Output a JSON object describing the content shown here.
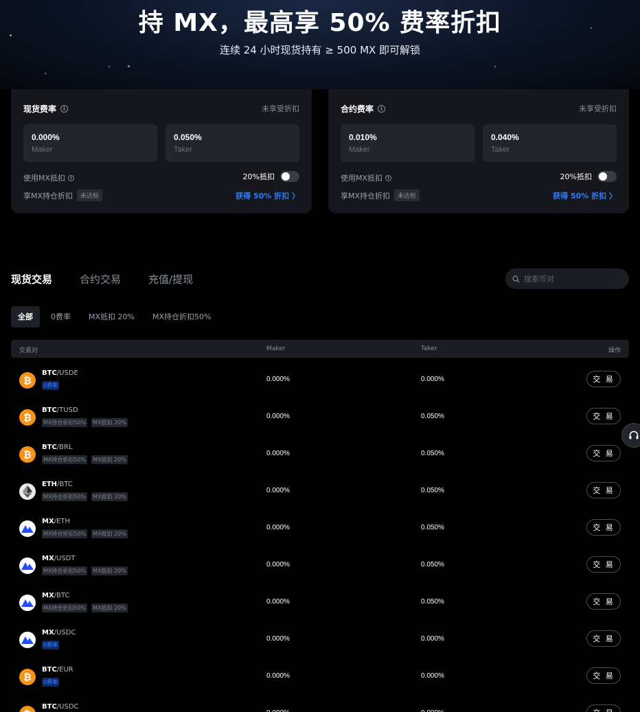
{
  "hero": {
    "title": "持 MX，最高享 50% 费率折扣",
    "subtitle": "连续 24 小时现货持有 ≥ 500 MX 即可解锁"
  },
  "cards": [
    {
      "title": "现货费率",
      "status": "未享受折扣",
      "maker_value": "0.000%",
      "maker_label": "Maker",
      "taker_value": "0.050%",
      "taker_label": "Taker",
      "mx_deduct_label": "使用MX抵扣",
      "mx_deduct_rate": "20%抵扣",
      "hold_label": "享MX持仓折扣",
      "hold_badge": "未达标",
      "hold_link": "获得 50% 折扣 〉"
    },
    {
      "title": "合约费率",
      "status": "未享受折扣",
      "maker_value": "0.010%",
      "maker_label": "Maker",
      "taker_value": "0.040%",
      "taker_label": "Taker",
      "mx_deduct_label": "使用MX抵扣",
      "mx_deduct_rate": "20%抵扣",
      "hold_label": "享MX持仓折扣",
      "hold_badge": "未达标",
      "hold_link": "获得 50% 折扣 〉"
    }
  ],
  "tabs": [
    "现货交易",
    "合约交易",
    "充值/提现"
  ],
  "search": {
    "placeholder": "搜索币对"
  },
  "filters": [
    "全部",
    "0费率",
    "MX抵扣 20%",
    "MX持仓折扣50%"
  ],
  "table": {
    "headers": {
      "pair": "交易对",
      "maker": "Maker",
      "taker": "Taker",
      "action": "操作"
    },
    "trade_label": "交 易",
    "rows": [
      {
        "coin": "btc",
        "base": "BTC",
        "quote": "/USDE",
        "tags": [
          {
            "text": "0费率",
            "style": "blue"
          }
        ],
        "maker": "0.000%",
        "taker": "0.000%"
      },
      {
        "coin": "btc",
        "base": "BTC",
        "quote": "/TUSD",
        "tags": [
          {
            "text": "MX持仓折扣50%",
            "style": "gray"
          },
          {
            "text": "MX抵扣 20%",
            "style": "gray"
          }
        ],
        "maker": "0.000%",
        "taker": "0.050%"
      },
      {
        "coin": "btc",
        "base": "BTC",
        "quote": "/BRL",
        "tags": [
          {
            "text": "MX持仓折扣50%",
            "style": "gray"
          },
          {
            "text": "MX抵扣 20%",
            "style": "gray"
          }
        ],
        "maker": "0.000%",
        "taker": "0.050%"
      },
      {
        "coin": "eth",
        "base": "ETH",
        "quote": "/BTC",
        "tags": [
          {
            "text": "MX持仓折扣50%",
            "style": "gray"
          },
          {
            "text": "MX抵扣 20%",
            "style": "gray"
          }
        ],
        "maker": "0.000%",
        "taker": "0.050%"
      },
      {
        "coin": "mx",
        "base": "MX",
        "quote": "/ETH",
        "tags": [
          {
            "text": "MX持仓折扣50%",
            "style": "gray"
          },
          {
            "text": "MX抵扣 20%",
            "style": "gray"
          }
        ],
        "maker": "0.000%",
        "taker": "0.050%"
      },
      {
        "coin": "mx",
        "base": "MX",
        "quote": "/USDT",
        "tags": [
          {
            "text": "MX持仓折扣50%",
            "style": "gray"
          },
          {
            "text": "MX抵扣 20%",
            "style": "gray"
          }
        ],
        "maker": "0.000%",
        "taker": "0.050%"
      },
      {
        "coin": "mx",
        "base": "MX",
        "quote": "/BTC",
        "tags": [
          {
            "text": "MX持仓折扣50%",
            "style": "gray"
          },
          {
            "text": "MX抵扣 20%",
            "style": "gray"
          }
        ],
        "maker": "0.000%",
        "taker": "0.050%"
      },
      {
        "coin": "mx",
        "base": "MX",
        "quote": "/USDC",
        "tags": [
          {
            "text": "0费率",
            "style": "blue"
          }
        ],
        "maker": "0.000%",
        "taker": "0.000%"
      },
      {
        "coin": "btc",
        "base": "BTC",
        "quote": "/EUR",
        "tags": [
          {
            "text": "0费率",
            "style": "blue"
          }
        ],
        "maker": "0.000%",
        "taker": "0.000%"
      },
      {
        "coin": "btc",
        "base": "BTC",
        "quote": "/USDC",
        "tags": [],
        "maker": "0.000%",
        "taker": "0.000%"
      }
    ]
  }
}
